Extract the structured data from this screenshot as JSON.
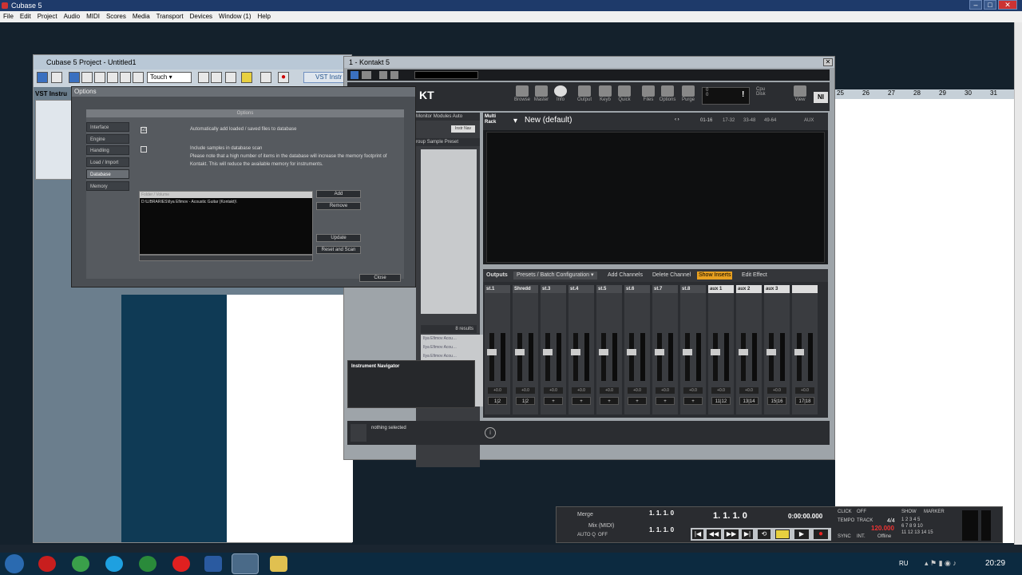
{
  "app": {
    "title": "Cubase 5"
  },
  "menu": [
    "File",
    "Edit",
    "Project",
    "Audio",
    "MIDI",
    "Scores",
    "Media",
    "Transport",
    "Devices",
    "Window (1)",
    "Help"
  ],
  "project": {
    "title": "Cubase 5 Project - Untitled1",
    "automation_mode": "Touch",
    "vst_label": "VST Instru",
    "vst_button": "VST Instr"
  },
  "ruler": [
    "25",
    "26",
    "27",
    "28",
    "29",
    "30",
    "31"
  ],
  "options": {
    "window_title": "Options",
    "header": "Options",
    "nav": [
      "Interface",
      "Engine",
      "Handling",
      "Load / Import",
      "Database",
      "Memory"
    ],
    "selected_nav": "Database",
    "auto_add_label": "Automatically add loaded / saved files to database",
    "auto_add_checked": "☑",
    "include_samples_label": "Include samples in database scan",
    "note": "Please note that a high number of items in the database will increase the memory footprint of Kontakt. This will reduce the available memory for instruments.",
    "folder_header": "Folder / Volume",
    "folder_entry": "D:\\LIBRARIES\\Ilya Efimov - Acoustic Guitar (Kontakt)\\",
    "btn_add": "Add",
    "btn_remove": "Remove",
    "btn_update": "Update",
    "btn_reset_scan": "Reset and Scan",
    "btn_close": "Close"
  },
  "kontakt": {
    "title": "1 - Kontakt 5",
    "header_buttons": [
      "Browse",
      "Master",
      "Info",
      "Output",
      "Keyb",
      "Quick",
      "Files",
      "Options",
      "Purge",
      "View"
    ],
    "cpu_label": "Cpu",
    "disk_label": "Disk",
    "voices": "0",
    "mem": "0",
    "browser_tabs": [
      "Monitor",
      "Modules",
      "Auto"
    ],
    "browser_filters": [
      "roup",
      "Sample",
      "Preset"
    ],
    "instr_nav_label": "Instr Nav",
    "results": "8 results",
    "results_list": [
      "Ilya Efimov Acou…",
      "Ilya Efimov Acou…",
      "Ilya Efimov Acou…",
      "The rhythms of t…",
      "The rhythms of t…",
      "The rhythms of t…"
    ],
    "instrument_navigator": "Instrument Navigator",
    "multi_rack_label": "Multi Rack",
    "multi_name": "New (default)",
    "rack_pages": [
      "01-16",
      "17-32",
      "33-48",
      "49-64"
    ],
    "aux_btn": "AUX",
    "outputs_label": "Outputs",
    "presets_label": "Presets / Batch Configuration",
    "add_channels": "Add Channels",
    "delete_channel": "Delete Channel",
    "show_inserts": "Show Inserts",
    "edit_effect": "Edit Effect",
    "strips": [
      {
        "name": "st.1",
        "value": "+0.0",
        "out": "1|2"
      },
      {
        "name": "Shredd",
        "value": "+0.0",
        "out": "1|2"
      },
      {
        "name": "st.3",
        "value": "+0.0",
        "out": "+"
      },
      {
        "name": "st.4",
        "value": "+0.0",
        "out": "+"
      },
      {
        "name": "st.5",
        "value": "+0.0",
        "out": "+"
      },
      {
        "name": "st.6",
        "value": "+0.0",
        "out": "+"
      },
      {
        "name": "st.7",
        "value": "+0.0",
        "out": "+"
      },
      {
        "name": "st.8",
        "value": "+0.0",
        "out": "+"
      },
      {
        "name": "aux 1",
        "value": "+0.0",
        "out": "11|12"
      },
      {
        "name": "aux 2",
        "value": "+0.0",
        "out": "13|14"
      },
      {
        "name": "aux 3",
        "value": "+0.0",
        "out": "15|16"
      },
      {
        "name": "",
        "value": "+0.0",
        "out": "17|18"
      }
    ],
    "status": "nothing selected"
  },
  "transport": {
    "merge": "Merge",
    "mix": "Mix (MIDI)",
    "autoq": "AUTO Q",
    "off": "OFF",
    "pos_left": "1. 1. 1.   0",
    "pos_right": "1. 1. 1.   0",
    "primary_pos": "1. 1. 1.   0",
    "time": "0:00:00.000",
    "click": "CLICK",
    "click_state": "OFF",
    "tempo_label": "TEMPO",
    "track_label": "TRACK",
    "signature": "4/4",
    "tempo": "120.000",
    "sync": "SYNC",
    "int": "INT.",
    "offline": "Offline",
    "show": "SHOW",
    "marker": "MARKER"
  },
  "taskbar": {
    "lang": "RU",
    "clock": "20:29"
  }
}
